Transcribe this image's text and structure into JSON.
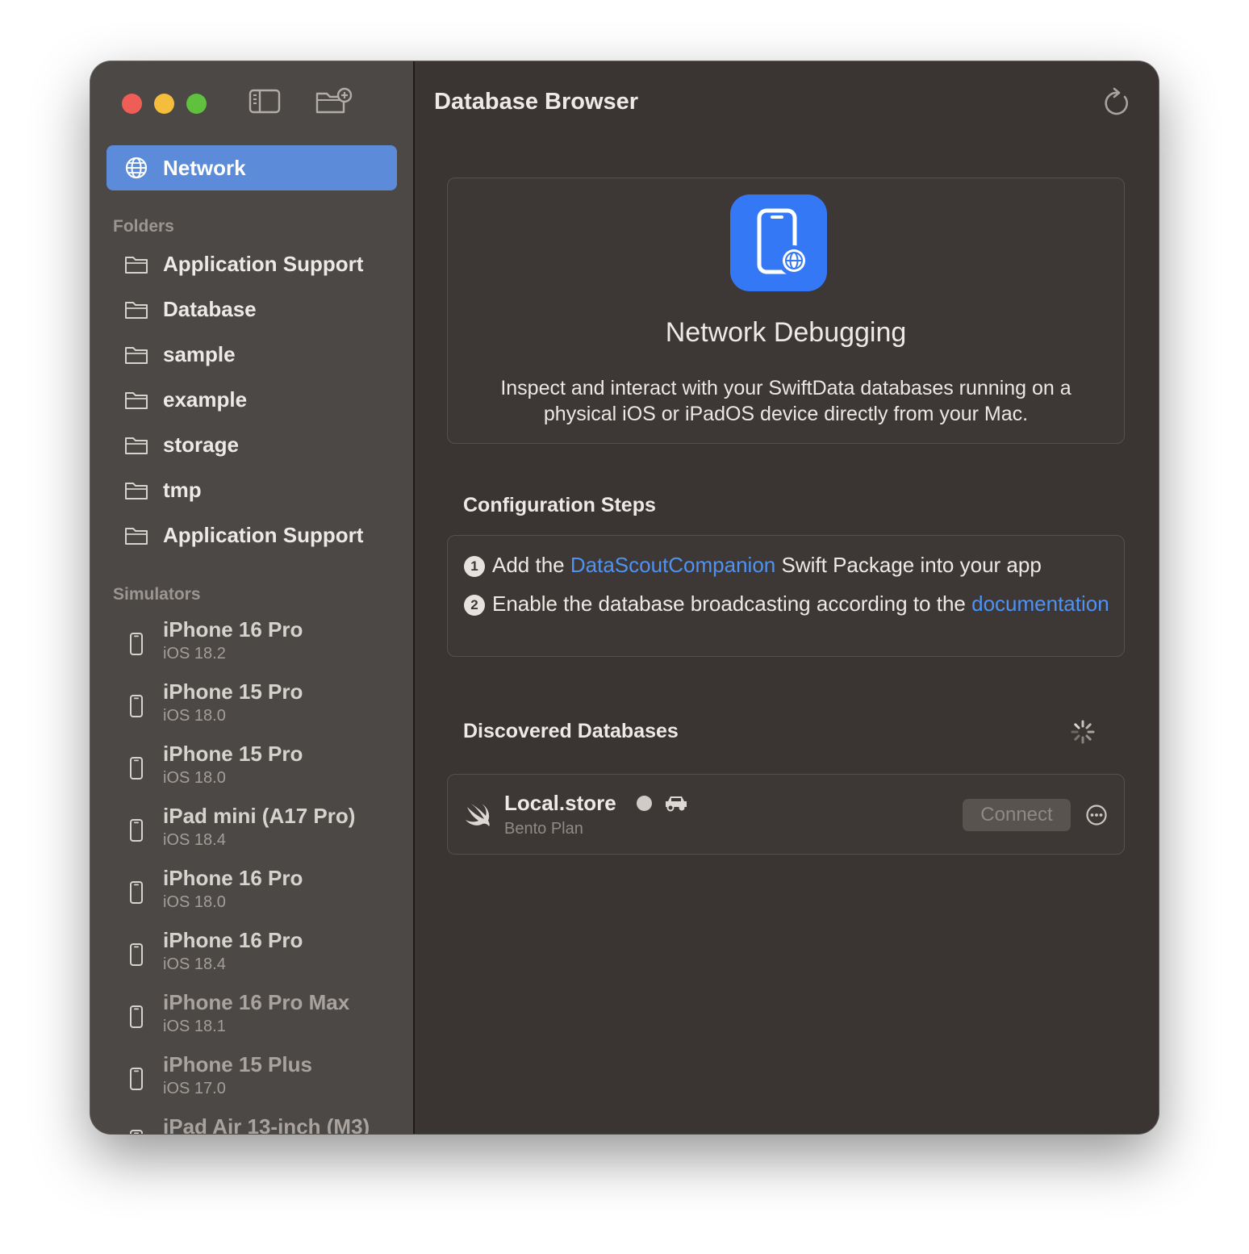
{
  "sidebar": {
    "selected": {
      "label": "Network",
      "icon": "globe-icon"
    },
    "folders_title": "Folders",
    "folders": [
      {
        "label": "Application Support"
      },
      {
        "label": "Database"
      },
      {
        "label": "sample"
      },
      {
        "label": "example"
      },
      {
        "label": "storage"
      },
      {
        "label": "tmp"
      },
      {
        "label": "Application Support"
      }
    ],
    "simulators_title": "Simulators",
    "simulators": [
      {
        "name": "iPhone 16 Pro",
        "os": "iOS 18.2"
      },
      {
        "name": "iPhone 15 Pro",
        "os": "iOS 18.0"
      },
      {
        "name": "iPhone 15 Pro",
        "os": "iOS 18.0"
      },
      {
        "name": "iPad mini (A17 Pro)",
        "os": "iOS 18.4"
      },
      {
        "name": "iPhone 16 Pro",
        "os": "iOS 18.0"
      },
      {
        "name": "iPhone 16 Pro",
        "os": "iOS 18.4"
      },
      {
        "name": "iPhone 16 Pro Max",
        "os": "iOS 18.1"
      },
      {
        "name": "iPhone 15 Plus",
        "os": "iOS 17.0"
      },
      {
        "name": "iPad Air 13-inch (M3)",
        "os": ""
      }
    ]
  },
  "main": {
    "title": "Database Browser",
    "hero": {
      "title": "Network Debugging",
      "description": "Inspect and interact with your SwiftData databases running on a physical iOS or iPadOS device directly from your Mac."
    },
    "config": {
      "title": "Configuration Steps",
      "step1_number": "1",
      "step1_prefix": "Add the",
      "step1_link": "DataScoutCompanion",
      "step1_suffix": "Swift Package into your app",
      "step2_number": "2",
      "step2_prefix": "Enable the database broadcasting according to the",
      "step2_link": "documentation"
    },
    "discovered": {
      "title": "Discovered Databases",
      "items": [
        {
          "name": "Local.store",
          "subtitle": "Bento Plan",
          "connect_label": "Connect"
        }
      ]
    }
  },
  "colors": {
    "accent": "#5b8bd9",
    "link": "#4e93f3",
    "app_icon": "#3478f6"
  }
}
